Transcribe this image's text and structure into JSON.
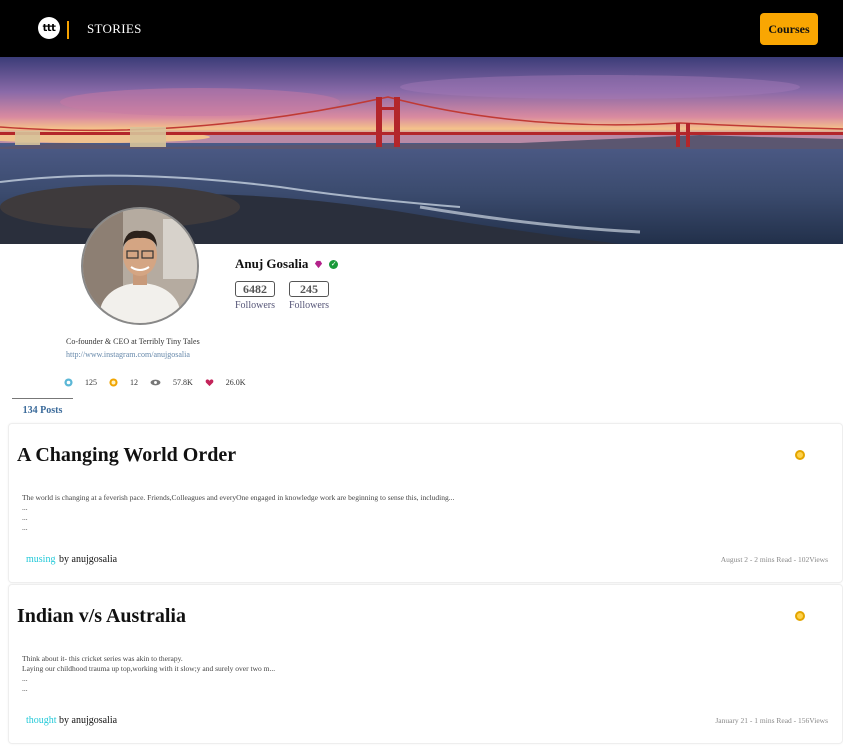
{
  "header": {
    "logo_text": "ttt",
    "nav_stories": "STORIES",
    "courses_label": "Courses"
  },
  "profile": {
    "name": "Anuj Gosalia",
    "followers": [
      {
        "count": "6482",
        "label": "Followers"
      },
      {
        "count": "245",
        "label": "Followers"
      }
    ],
    "bio": "Co-founder & CEO at Terribly Tiny Tales",
    "link": "http://www.instagram.com/anujgosalia",
    "metrics": [
      {
        "icon": "star-badge-icon",
        "value": "125",
        "color": "#5bb7d6"
      },
      {
        "icon": "coin-icon",
        "value": "12",
        "color": "#f0a400"
      },
      {
        "icon": "eye-icon",
        "value": "57.8K",
        "color": "#777777"
      },
      {
        "icon": "heart-icon",
        "value": "26.0K",
        "color": "#c3245a"
      }
    ],
    "posts_tab": "134 Posts"
  },
  "posts": [
    {
      "title": "A Changing World Order",
      "excerpt": [
        "The world is changing at a feverish pace. Friends,Colleagues and everyOne engaged in knowledge work are beginning to sense this, including...",
        "...",
        "...",
        "..."
      ],
      "tag": "musing",
      "by": "by anujgosalia",
      "meta": "August 2 - 2 mins Read - 102Views"
    },
    {
      "title": "Indian v/s Australia",
      "excerpt": [
        "Think about it- this cricket series was akin to therapy.",
        "Laying our childhood trauma up top,working with it slow;y and surely over two m...",
        "...",
        "..."
      ],
      "tag": "thought",
      "by": "by anujgosalia",
      "meta": "January 21 - 1 mins Read - 156Views"
    }
  ],
  "colors": {
    "accent": "#f9a602",
    "tag": "#23c9d8",
    "link": "#6688aa"
  }
}
